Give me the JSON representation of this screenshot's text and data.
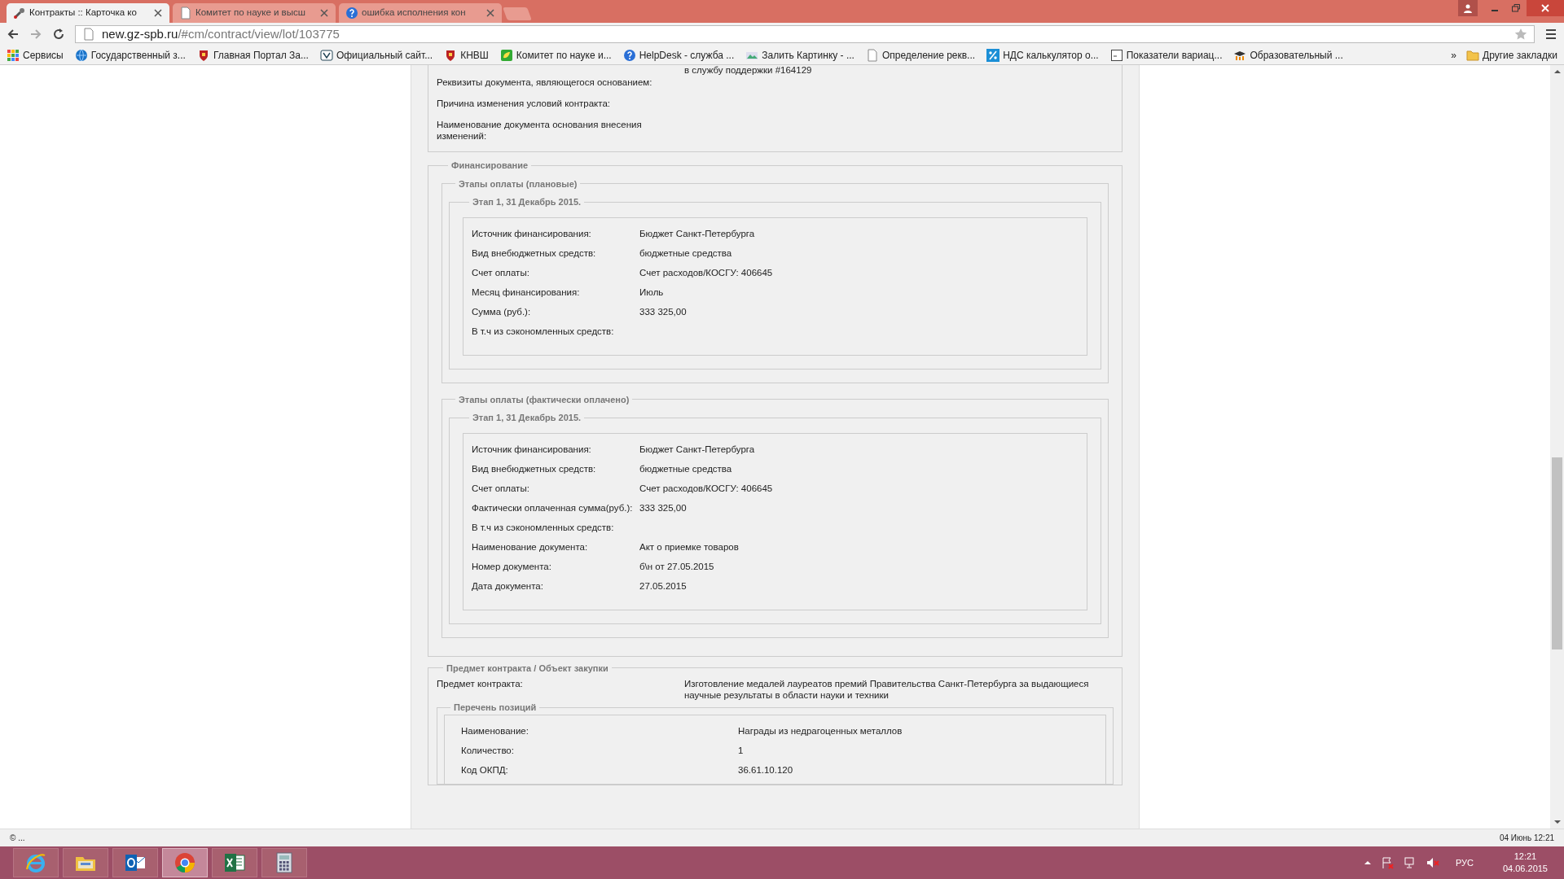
{
  "browser": {
    "tabs": [
      {
        "title": "Контракты :: Карточка ко",
        "selected": true
      },
      {
        "title": "Комитет по науке и высш",
        "selected": false
      },
      {
        "title": "ошибка исполнения кон",
        "selected": false
      }
    ],
    "address": {
      "host": "new.gz-spb.ru",
      "path": "/#cm/contract/view/lot/103775"
    },
    "bookmarks": [
      {
        "label": "Сервисы"
      },
      {
        "label": "Государственный з..."
      },
      {
        "label": "Главная Портал За..."
      },
      {
        "label": "Официальный сайт..."
      },
      {
        "label": "КНВШ"
      },
      {
        "label": "Комитет по науке и..."
      },
      {
        "label": "HelpDesk - служба ..."
      },
      {
        "label": "Залить Картинку - ..."
      },
      {
        "label": "Определение рекв..."
      },
      {
        "label": "НДС калькулятор о..."
      },
      {
        "label": "Показатели вариац..."
      },
      {
        "label": "Образовательный ..."
      }
    ],
    "more": "»",
    "other_bookmarks": "Другие закладки"
  },
  "page": {
    "cut_text": "в службу поддержки #164129",
    "top_fields": [
      {
        "label": "Реквизиты документа, являющегося основанием:"
      },
      {
        "label": "Причина изменения условий контракта:"
      },
      {
        "label": "Наименование документа основания внесения изменений:"
      }
    ],
    "financing": {
      "legend": "Финансирование",
      "groups": [
        {
          "legend": "Этапы оплаты (плановые)",
          "stages": [
            {
              "legend": "Этап 1, 31 Декабрь 2015.",
              "fields": [
                {
                  "label": "Источник финансирования:",
                  "value": "Бюджет Санкт-Петербурга"
                },
                {
                  "label": "Вид внебюджетных средств:",
                  "value": "бюджетные средства"
                },
                {
                  "label": "Счет оплаты:",
                  "value": "Счет расходов/КОСГУ: 406645"
                },
                {
                  "label": "Месяц финансирования:",
                  "value": "Июль"
                },
                {
                  "label": "Сумма (руб.):",
                  "value": "333 325,00"
                },
                {
                  "label": "В т.ч из сэкономленных средств:"
                }
              ]
            }
          ]
        },
        {
          "legend": "Этапы оплаты (фактически оплачено)",
          "stages": [
            {
              "legend": "Этап 1, 31 Декабрь 2015.",
              "fields": [
                {
                  "label": "Источник финансирования:",
                  "value": "Бюджет Санкт-Петербурга"
                },
                {
                  "label": "Вид внебюджетных средств:",
                  "value": "бюджетные средства"
                },
                {
                  "label": "Счет оплаты:",
                  "value": "Счет расходов/КОСГУ: 406645"
                },
                {
                  "label": "Фактически оплаченная сумма(руб.):",
                  "value": "333 325,00"
                },
                {
                  "label": "В т.ч из сэкономленных средств:"
                },
                {
                  "label": "Наименование документа:",
                  "value": "Акт о приемке товаров"
                },
                {
                  "label": "Номер документа:",
                  "value": "б\\н от 27.05.2015"
                },
                {
                  "label": "Дата документа:",
                  "value": "27.05.2015"
                }
              ]
            }
          ]
        }
      ]
    },
    "subject": {
      "legend": "Предмет контракта / Объект закупки",
      "fields": [
        {
          "label": "Предмет контракта:",
          "value": "Изготовление медалей лауреатов премий Правительства Санкт-Петербурга за выдающиеся научные результаты в области науки и техники"
        }
      ],
      "positions": {
        "legend": "Перечень позиций",
        "fields": [
          {
            "label": "Наименование:",
            "value": "Награды из недрагоценных металлов"
          },
          {
            "label": "Количество:",
            "value": "1"
          },
          {
            "label": "Код ОКПД:",
            "value": "36.61.10.120"
          }
        ]
      }
    }
  },
  "status_bar": {
    "left": "© ...",
    "right": "04 Июнь 12:21"
  },
  "taskbar": {
    "apps": [
      {
        "kind": "ie",
        "selected": false
      },
      {
        "kind": "explorer",
        "selected": false
      },
      {
        "kind": "outlook",
        "selected": false
      },
      {
        "kind": "chrome",
        "selected": true
      },
      {
        "kind": "excel",
        "selected": false
      },
      {
        "kind": "calculator",
        "selected": false
      }
    ],
    "language": "РУС",
    "time": "12:21",
    "date": "04.06.2015"
  }
}
